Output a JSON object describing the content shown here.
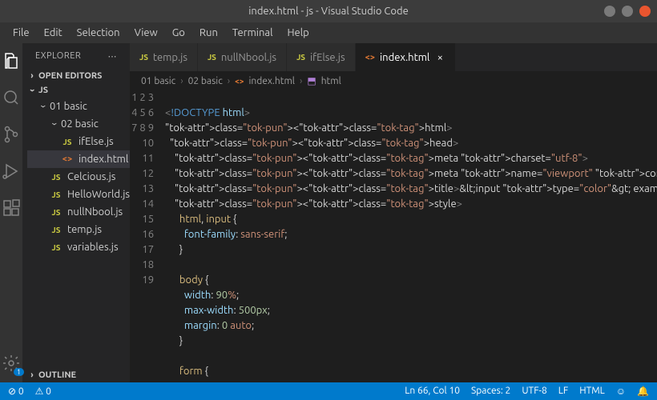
{
  "title": "index.html - js - Visual Studio Code",
  "menubar": [
    "File",
    "Edit",
    "Selection",
    "View",
    "Go",
    "Run",
    "Terminal",
    "Help"
  ],
  "activity_bar": {
    "badge": "1"
  },
  "sidebar": {
    "title": "EXPLORER",
    "sections": {
      "open_editors": "OPEN EDITORS",
      "workspace": "JS",
      "outline": "OUTLINE"
    },
    "tree": {
      "folder1": "01 basic",
      "folder2": "02 basic",
      "files_nested": [
        "ifElse.js",
        "index.html"
      ],
      "files_root": [
        "Celcious.js",
        "HelloWorld.js",
        "nullNbool.js",
        "temp.js",
        "variables.js"
      ]
    }
  },
  "tabs": [
    {
      "label": "temp.js",
      "type": "js",
      "active": false
    },
    {
      "label": "nullNbool.js",
      "type": "js",
      "active": false
    },
    {
      "label": "ifElse.js",
      "type": "js",
      "active": false
    },
    {
      "label": "index.html",
      "type": "html",
      "active": true
    }
  ],
  "breadcrumbs": [
    "01 basic",
    "02 basic",
    "index.html",
    "html"
  ],
  "statusbar": {
    "errors": "0",
    "warnings": "0",
    "position": "Ln 66, Col 10",
    "spaces": "Spaces: 2",
    "encoding": "UTF-8",
    "eol": "LF",
    "language": "HTML"
  },
  "code": [
    "",
    "<!DOCTYPE html>",
    "<html>",
    "  <head>",
    "    <meta charset=\"utf-8\">",
    "    <meta name=\"viewport\" content=\"width=device-width\">",
    "    <title>&lt;input type=\"color\"&gt; example</title>",
    "    <style>",
    "      html, input {",
    "        font-family: sans-serif;",
    "      }",
    "",
    "      body {",
    "        width: 90%;",
    "        max-width: 500px;",
    "        margin: 0 auto;",
    "      }",
    "",
    "      form {"
  ]
}
